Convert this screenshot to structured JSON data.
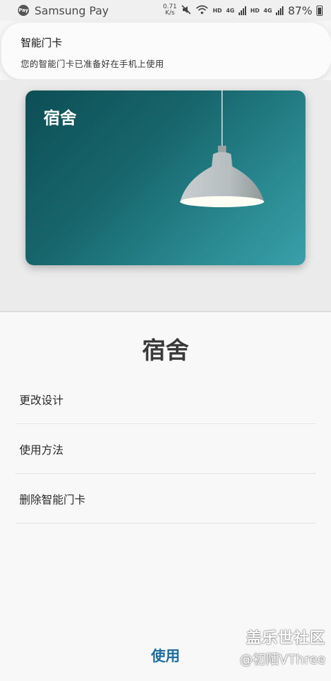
{
  "status_bar": {
    "app_name": "Samsung Pay",
    "speed": "0.71",
    "speed_unit": "K/s",
    "network1": "HD",
    "network1_gen": "4G",
    "network2": "HD",
    "network2_gen": "4G",
    "battery": "87%",
    "pay_icon_text": "Pay"
  },
  "notification": {
    "title": "智能门卡",
    "text": "您的智能门卡已准备好在手机上使用"
  },
  "card": {
    "title": "宿舍"
  },
  "sheet": {
    "title": "宿舍",
    "menu": [
      {
        "label": "更改设计"
      },
      {
        "label": "使用方法"
      },
      {
        "label": "删除智能门卡"
      }
    ],
    "use_button": "使用"
  },
  "watermark": {
    "line1": "盖乐世社区",
    "line2": "@初陌VThree"
  }
}
